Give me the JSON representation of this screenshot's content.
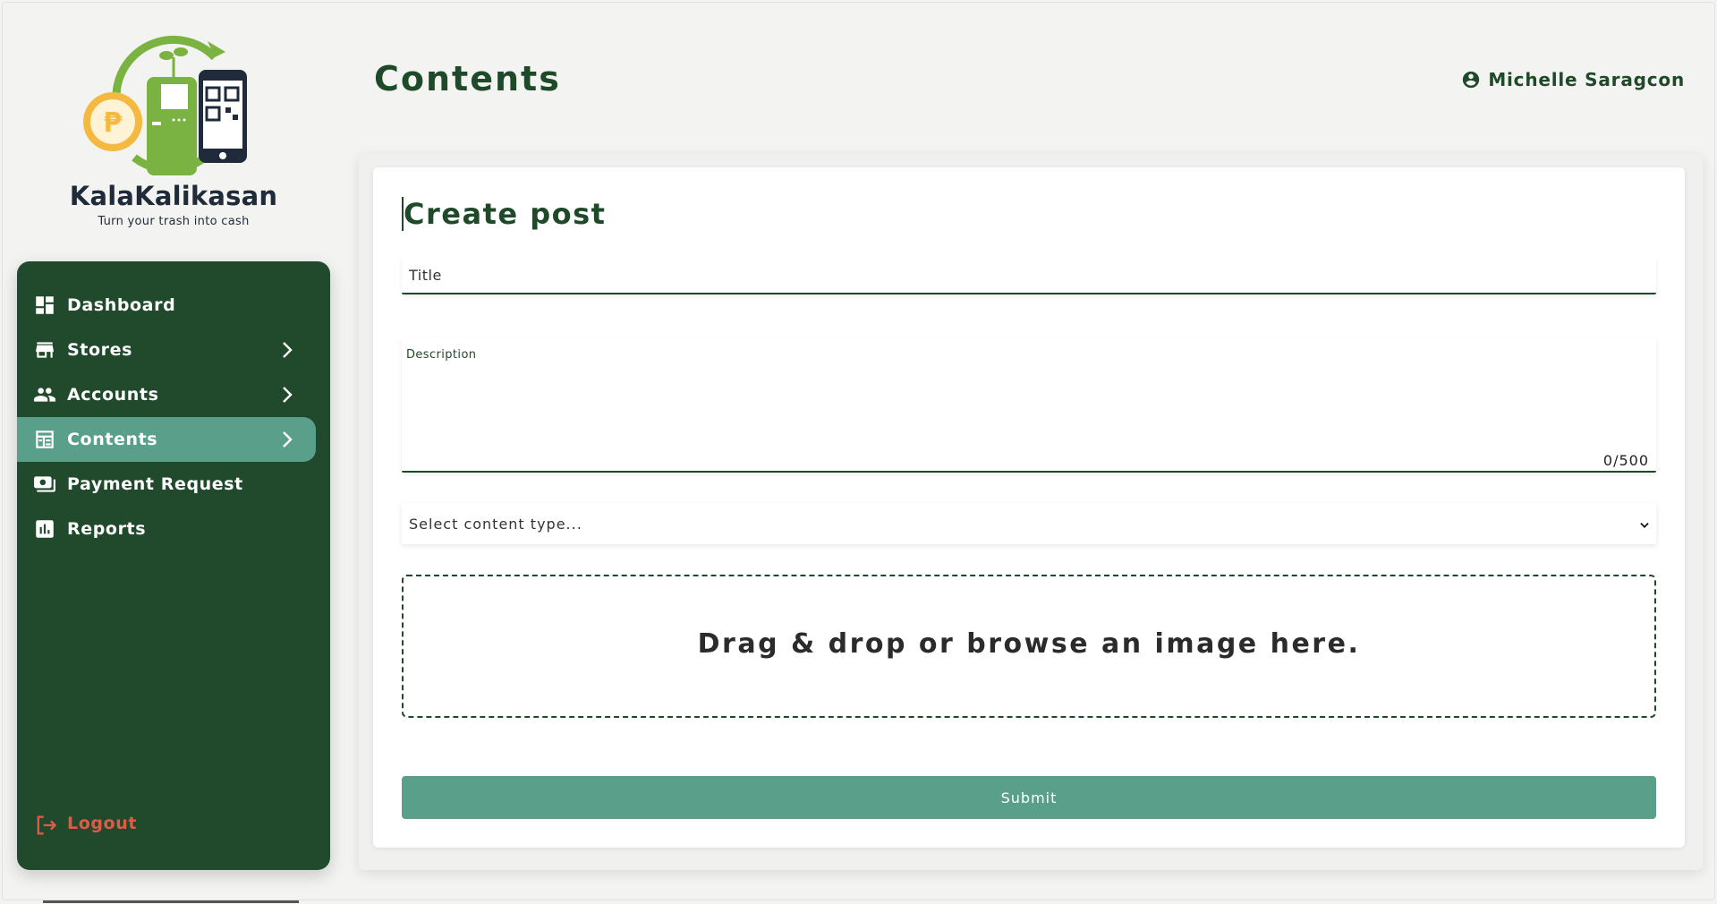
{
  "brand": {
    "name": "KalaKalikasan",
    "tagline": "Turn your trash into cash",
    "colors": {
      "green": "#7ab342",
      "gold": "#f5b940",
      "navy": "#1f2b3a"
    }
  },
  "sidebar": {
    "background": "#214a2c",
    "active_color": "#5a9f8a",
    "items": [
      {
        "label": "Dashboard",
        "icon": "dashboard-icon",
        "has_chevron": false,
        "active": false
      },
      {
        "label": "Stores",
        "icon": "store-icon",
        "has_chevron": true,
        "active": false
      },
      {
        "label": "Accounts",
        "icon": "people-icon",
        "has_chevron": true,
        "active": false
      },
      {
        "label": "Contents",
        "icon": "contents-icon",
        "has_chevron": true,
        "active": true
      },
      {
        "label": "Payment Request",
        "icon": "payment-icon",
        "has_chevron": false,
        "active": false
      },
      {
        "label": "Reports",
        "icon": "reports-icon",
        "has_chevron": false,
        "active": false
      }
    ],
    "logout": {
      "label": "Logout",
      "icon": "logout-icon",
      "color": "#e05a48"
    }
  },
  "header": {
    "title": "Contents",
    "user": {
      "name": "Michelle Saragcon",
      "icon": "user-circle-icon"
    }
  },
  "form": {
    "heading": "Create post",
    "title_placeholder": "Title",
    "description_label": "Description",
    "description_count": "0/500",
    "content_type_placeholder": "Select content type...",
    "dropzone_text": "Drag & drop or browse an image here.",
    "submit_label": "Submit"
  }
}
